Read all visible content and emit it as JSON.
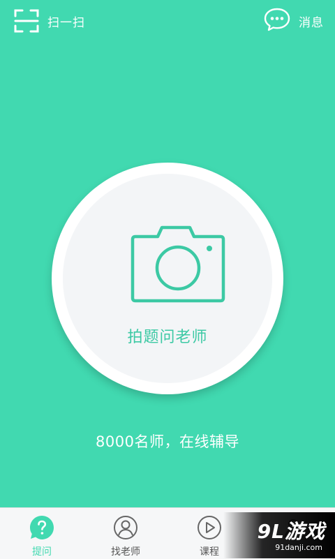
{
  "topbar": {
    "scan_label": "扫一扫",
    "message_label": "消息"
  },
  "main": {
    "camera_button_label": "拍题问老师",
    "tagline": "8000名师，在线辅导"
  },
  "tabs": [
    {
      "label": "提问",
      "icon": "question-bubble-icon",
      "active": true
    },
    {
      "label": "找老师",
      "icon": "teacher-icon",
      "active": false
    },
    {
      "label": "课程",
      "icon": "play-icon",
      "active": false
    },
    {
      "label": "",
      "icon": "profile-icon",
      "active": false
    }
  ],
  "watermark": {
    "logo": "9L游戏",
    "url": "91danji.com"
  },
  "colors": {
    "accent": "#41d9b0",
    "label_green": "#3cc9a4",
    "tabbar_bg": "#f6f7f8",
    "inactive_tab": "#555555"
  }
}
